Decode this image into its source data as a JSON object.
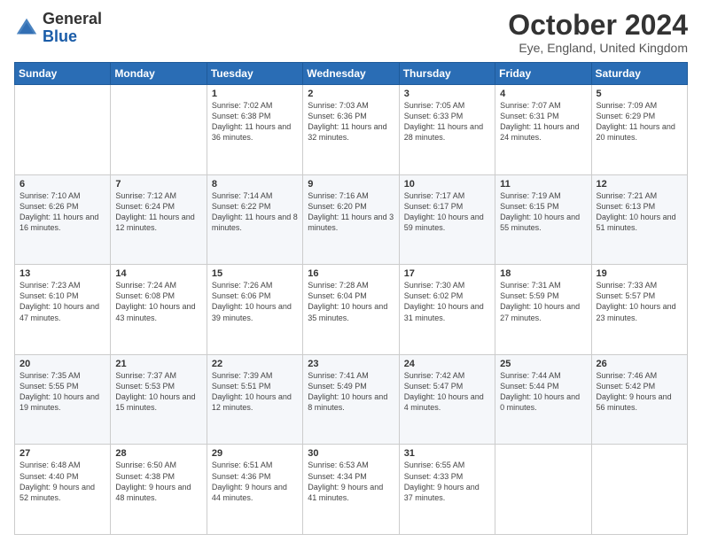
{
  "header": {
    "logo_general": "General",
    "logo_blue": "Blue",
    "month_title": "October 2024",
    "location": "Eye, England, United Kingdom"
  },
  "days_of_week": [
    "Sunday",
    "Monday",
    "Tuesday",
    "Wednesday",
    "Thursday",
    "Friday",
    "Saturday"
  ],
  "weeks": [
    [
      {
        "day": "",
        "info": ""
      },
      {
        "day": "",
        "info": ""
      },
      {
        "day": "1",
        "info": "Sunrise: 7:02 AM\nSunset: 6:38 PM\nDaylight: 11 hours and 36 minutes."
      },
      {
        "day": "2",
        "info": "Sunrise: 7:03 AM\nSunset: 6:36 PM\nDaylight: 11 hours and 32 minutes."
      },
      {
        "day": "3",
        "info": "Sunrise: 7:05 AM\nSunset: 6:33 PM\nDaylight: 11 hours and 28 minutes."
      },
      {
        "day": "4",
        "info": "Sunrise: 7:07 AM\nSunset: 6:31 PM\nDaylight: 11 hours and 24 minutes."
      },
      {
        "day": "5",
        "info": "Sunrise: 7:09 AM\nSunset: 6:29 PM\nDaylight: 11 hours and 20 minutes."
      }
    ],
    [
      {
        "day": "6",
        "info": "Sunrise: 7:10 AM\nSunset: 6:26 PM\nDaylight: 11 hours and 16 minutes."
      },
      {
        "day": "7",
        "info": "Sunrise: 7:12 AM\nSunset: 6:24 PM\nDaylight: 11 hours and 12 minutes."
      },
      {
        "day": "8",
        "info": "Sunrise: 7:14 AM\nSunset: 6:22 PM\nDaylight: 11 hours and 8 minutes."
      },
      {
        "day": "9",
        "info": "Sunrise: 7:16 AM\nSunset: 6:20 PM\nDaylight: 11 hours and 3 minutes."
      },
      {
        "day": "10",
        "info": "Sunrise: 7:17 AM\nSunset: 6:17 PM\nDaylight: 10 hours and 59 minutes."
      },
      {
        "day": "11",
        "info": "Sunrise: 7:19 AM\nSunset: 6:15 PM\nDaylight: 10 hours and 55 minutes."
      },
      {
        "day": "12",
        "info": "Sunrise: 7:21 AM\nSunset: 6:13 PM\nDaylight: 10 hours and 51 minutes."
      }
    ],
    [
      {
        "day": "13",
        "info": "Sunrise: 7:23 AM\nSunset: 6:10 PM\nDaylight: 10 hours and 47 minutes."
      },
      {
        "day": "14",
        "info": "Sunrise: 7:24 AM\nSunset: 6:08 PM\nDaylight: 10 hours and 43 minutes."
      },
      {
        "day": "15",
        "info": "Sunrise: 7:26 AM\nSunset: 6:06 PM\nDaylight: 10 hours and 39 minutes."
      },
      {
        "day": "16",
        "info": "Sunrise: 7:28 AM\nSunset: 6:04 PM\nDaylight: 10 hours and 35 minutes."
      },
      {
        "day": "17",
        "info": "Sunrise: 7:30 AM\nSunset: 6:02 PM\nDaylight: 10 hours and 31 minutes."
      },
      {
        "day": "18",
        "info": "Sunrise: 7:31 AM\nSunset: 5:59 PM\nDaylight: 10 hours and 27 minutes."
      },
      {
        "day": "19",
        "info": "Sunrise: 7:33 AM\nSunset: 5:57 PM\nDaylight: 10 hours and 23 minutes."
      }
    ],
    [
      {
        "day": "20",
        "info": "Sunrise: 7:35 AM\nSunset: 5:55 PM\nDaylight: 10 hours and 19 minutes."
      },
      {
        "day": "21",
        "info": "Sunrise: 7:37 AM\nSunset: 5:53 PM\nDaylight: 10 hours and 15 minutes."
      },
      {
        "day": "22",
        "info": "Sunrise: 7:39 AM\nSunset: 5:51 PM\nDaylight: 10 hours and 12 minutes."
      },
      {
        "day": "23",
        "info": "Sunrise: 7:41 AM\nSunset: 5:49 PM\nDaylight: 10 hours and 8 minutes."
      },
      {
        "day": "24",
        "info": "Sunrise: 7:42 AM\nSunset: 5:47 PM\nDaylight: 10 hours and 4 minutes."
      },
      {
        "day": "25",
        "info": "Sunrise: 7:44 AM\nSunset: 5:44 PM\nDaylight: 10 hours and 0 minutes."
      },
      {
        "day": "26",
        "info": "Sunrise: 7:46 AM\nSunset: 5:42 PM\nDaylight: 9 hours and 56 minutes."
      }
    ],
    [
      {
        "day": "27",
        "info": "Sunrise: 6:48 AM\nSunset: 4:40 PM\nDaylight: 9 hours and 52 minutes."
      },
      {
        "day": "28",
        "info": "Sunrise: 6:50 AM\nSunset: 4:38 PM\nDaylight: 9 hours and 48 minutes."
      },
      {
        "day": "29",
        "info": "Sunrise: 6:51 AM\nSunset: 4:36 PM\nDaylight: 9 hours and 44 minutes."
      },
      {
        "day": "30",
        "info": "Sunrise: 6:53 AM\nSunset: 4:34 PM\nDaylight: 9 hours and 41 minutes."
      },
      {
        "day": "31",
        "info": "Sunrise: 6:55 AM\nSunset: 4:33 PM\nDaylight: 9 hours and 37 minutes."
      },
      {
        "day": "",
        "info": ""
      },
      {
        "day": "",
        "info": ""
      }
    ]
  ]
}
